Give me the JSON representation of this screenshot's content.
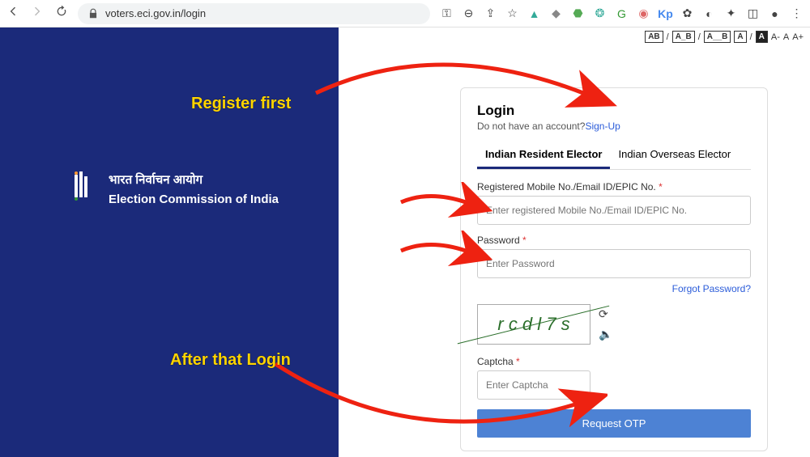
{
  "browser": {
    "url": "voters.eci.gov.in/login"
  },
  "a11y": {
    "ab": "AB",
    "a_b": "A_B",
    "a__b": "A__B",
    "a1": "A",
    "a2": "A",
    "aminus": "A-",
    "a3": "A",
    "aplus": "A+"
  },
  "brand": {
    "hindi": "भारत निर्वाचन आयोग",
    "english": "Election Commission of India"
  },
  "login": {
    "title": "Login",
    "no_account": "Do not have an account?",
    "signup": "Sign-Up",
    "tab1": "Indian Resident Elector",
    "tab2": "Indian Overseas Elector",
    "id_label": "Registered Mobile No./Email ID/EPIC No.",
    "id_placeholder": "Enter registered Mobile No./Email ID/EPIC No.",
    "pw_label": "Password",
    "pw_placeholder": "Enter Password",
    "forgot": "Forgot Password?",
    "captcha_text": "r c d l 7 s",
    "captcha_label": "Captcha",
    "captcha_placeholder": "Enter Captcha",
    "submit": "Request OTP",
    "asterisk": "*"
  },
  "annotations": {
    "register": "Register first",
    "after": "After that Login"
  }
}
